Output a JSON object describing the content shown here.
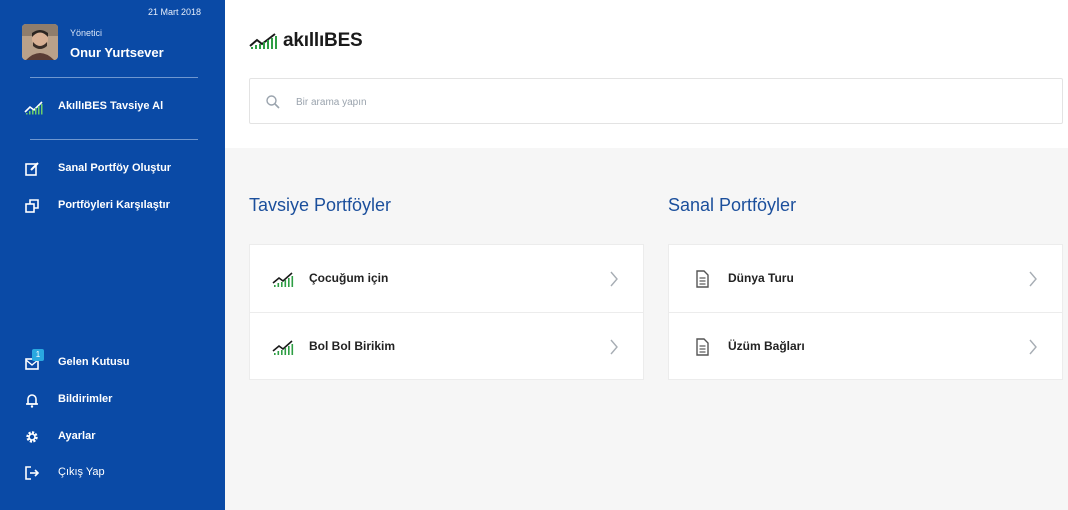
{
  "sidebar": {
    "date": "21 Mart 2018",
    "user": {
      "role": "Yönetici",
      "name": "Onur Yurtsever"
    },
    "primary": {
      "label": "AkıllıBES Tavsiye Al",
      "icon": "trend-chart-icon"
    },
    "items": [
      {
        "label": "Sanal Portföy Oluştur",
        "icon": "edit-icon"
      },
      {
        "label": "Portföyleri Karşılaştır",
        "icon": "copy-icon"
      }
    ],
    "bottom_items": [
      {
        "label": "Gelen Kutusu",
        "icon": "inbox-icon",
        "badge": "1"
      },
      {
        "label": "Bildirimler",
        "icon": "bell-icon"
      },
      {
        "label": "Ayarlar",
        "icon": "gear-icon"
      },
      {
        "label": "Çıkış Yap",
        "icon": "logout-icon"
      }
    ]
  },
  "header": {
    "logo_text": "akıllıBES",
    "search_placeholder": "Bir arama yapın"
  },
  "sections": {
    "recommended": {
      "title": "Tavsiye Portföyler",
      "items": [
        {
          "label": "Çocuğum için",
          "icon": "trend-chart-icon"
        },
        {
          "label": "Bol Bol Birikim",
          "icon": "trend-chart-icon"
        }
      ]
    },
    "virtual": {
      "title": "Sanal Portföyler",
      "items": [
        {
          "label": "Dünya Turu",
          "icon": "document-icon"
        },
        {
          "label": "Üzüm Bağları",
          "icon": "document-icon"
        }
      ]
    }
  },
  "colors": {
    "sidebar_bg": "#0a4aa6",
    "accent": "#1b4f9c",
    "chart_green": "#2e9e44",
    "badge": "#29a8e0"
  }
}
